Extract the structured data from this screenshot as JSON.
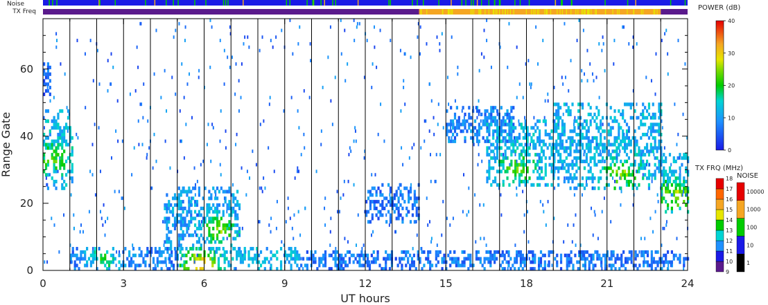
{
  "chart_data": {
    "type": "heatmap",
    "xlabel": "UT hours",
    "ylabel": "Range Gate",
    "xlim": [
      0,
      24
    ],
    "ylim": [
      0,
      75
    ],
    "x_ticks": [
      0,
      3,
      6,
      9,
      12,
      15,
      18,
      21,
      24
    ],
    "y_ticks": [
      0,
      20,
      40,
      60
    ],
    "status_bars": {
      "noise_label": "Noise",
      "txfreq_label": "TX Freq",
      "noise_color": "#1a1ae6",
      "txfreq_segments": [
        {
          "start": 0,
          "end": 14.0,
          "color": "#5a1a8c"
        },
        {
          "start": 14.0,
          "end": 23.0,
          "color": "#f5a623"
        },
        {
          "start": 23.0,
          "end": 24,
          "color": "#5a1a8c"
        }
      ]
    },
    "scan_boundaries": [
      1.0,
      2.0,
      3.0,
      4.0,
      5.0,
      6.0,
      7.0,
      8.0,
      9.0,
      10.0,
      11.0,
      12.0,
      13.0,
      14.0,
      15.0,
      16.0,
      17.0,
      18.0,
      19.0,
      20.0,
      21.0,
      22.0,
      23.0
    ],
    "echo_regions": [
      {
        "t0": 0.0,
        "t1": 1.1,
        "g0": 24,
        "g1": 48,
        "power": 12,
        "peak": {
          "t": 0.3,
          "g": 33,
          "power": 22
        }
      },
      {
        "t0": 0.0,
        "t1": 0.3,
        "g0": 52,
        "g1": 62,
        "power": 6
      },
      {
        "t0": 1.0,
        "t1": 5.0,
        "g0": 0,
        "g1": 7,
        "power": 8,
        "peak": {
          "t": 2.2,
          "g": 3,
          "power": 18
        }
      },
      {
        "t0": 4.5,
        "t1": 7.3,
        "g0": 6,
        "g1": 25,
        "power": 10,
        "peak": {
          "t": 6.5,
          "g": 12,
          "power": 24
        }
      },
      {
        "t0": 5.0,
        "t1": 9.5,
        "g0": 0,
        "g1": 7,
        "power": 12,
        "peak": {
          "t": 5.8,
          "g": 1,
          "power": 32
        }
      },
      {
        "t0": 9.5,
        "t1": 24.0,
        "g0": 0,
        "g1": 6,
        "power": 7
      },
      {
        "t0": 12.0,
        "t1": 14.0,
        "g0": 14,
        "g1": 26,
        "power": 7
      },
      {
        "t0": 15.0,
        "t1": 17.5,
        "g0": 38,
        "g1": 49,
        "power": 8
      },
      {
        "t0": 16.5,
        "t1": 19.0,
        "g0": 25,
        "g1": 45,
        "power": 12,
        "peak": {
          "t": 17.6,
          "g": 30,
          "power": 22
        }
      },
      {
        "t0": 19.0,
        "t1": 23.0,
        "g0": 24,
        "g1": 50,
        "power": 12,
        "peak": {
          "t": 21.5,
          "g": 28,
          "power": 24
        }
      },
      {
        "t0": 23.0,
        "t1": 24.0,
        "g0": 17,
        "g1": 35,
        "power": 12,
        "peak": {
          "t": 23.5,
          "g": 22,
          "power": 26
        }
      }
    ],
    "power_colorbar": {
      "title": "POWER (dB)",
      "min": 0,
      "max": 40,
      "ticks": [
        0,
        10,
        20,
        30,
        40
      ]
    },
    "txfreq_colorbar": {
      "title": "TX FRQ (MHz)",
      "ticks": [
        9,
        10,
        11,
        12,
        13,
        14,
        15,
        16,
        17,
        18
      ],
      "colors": [
        "#000000",
        "#5a1a8c",
        "#1a1ae6",
        "#1e90ff",
        "#00d4d4",
        "#00cc00",
        "#e6e600",
        "#f5a623",
        "#ff6600",
        "#e60000"
      ]
    },
    "noise_colorbar": {
      "title": "NOISE",
      "ticks": [
        "1",
        "10",
        "100",
        "1000",
        "10000"
      ],
      "colors": [
        "#000000",
        "#1a1ae6",
        "#00cc00",
        "#f5a623",
        "#e60000"
      ]
    }
  }
}
